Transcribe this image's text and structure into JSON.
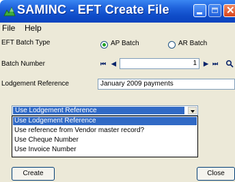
{
  "window": {
    "title": "SAMINC - EFT Create File"
  },
  "menu": {
    "file": "File",
    "help": "Help"
  },
  "form": {
    "batch_type_label": "EFT Batch Type",
    "ap_batch_label": "AP Batch",
    "ar_batch_label": "AR Batch",
    "selected_batch_type": "AP Batch",
    "batch_number_label": "Batch Number",
    "batch_number_value": "1",
    "lodgement_label": "Lodgement Reference",
    "lodgement_value": "January 2009 payments"
  },
  "reference_select": {
    "selected": "Use Lodgement Reference",
    "options": [
      "Use Lodgement Reference",
      "Use reference from Vendor master record?",
      "Use Cheque Number",
      "Use Invoice Number"
    ]
  },
  "buttons": {
    "create": "Create",
    "close": "Close"
  },
  "colors": {
    "title_bar": "#0f4cc8",
    "selection": "#316ac5",
    "form_background": "#ece9d8"
  }
}
